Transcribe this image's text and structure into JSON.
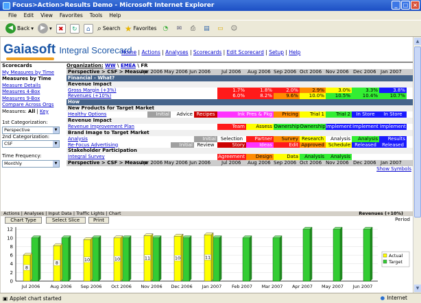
{
  "window": {
    "title": "Focus>Action>Results Demo - Microsoft Internet Explorer",
    "menu": [
      "File",
      "Edit",
      "View",
      "Favorites",
      "Tools",
      "Help"
    ],
    "toolbar": {
      "back": "Back",
      "search": "Search",
      "favorites": "Favorites"
    },
    "status": "Applet chart started",
    "zone": "Internet"
  },
  "header": {
    "logo": "Gaiasoft",
    "product": "Integral Scorecard",
    "nav": [
      "Home",
      "Actions",
      "Analyses",
      "Scorecards",
      "Edit Scorecard",
      "Setup",
      "Help"
    ]
  },
  "left": {
    "scorecards_title": "Scorecards",
    "my_measures": "My Measures by Time",
    "measures_by_time": "Measures by Time",
    "links": [
      "Measure Details",
      "Measures 4-Box",
      "Measures 9-Box",
      "Compare Across Orgs"
    ],
    "measures_label": "Measures:",
    "measures_all": "All",
    "measures_key": "Key",
    "cat1_label": "1st Categorization:",
    "cat1_value": "Perspective",
    "cat2_label": "2nd Categorization:",
    "cat2_value": "CSF",
    "freq_label": "Time Frequency:",
    "freq_value": "Monthly"
  },
  "org": {
    "label": "Organization:",
    "path": [
      "WW",
      "EMEA",
      "FR"
    ],
    "sep": "\\"
  },
  "grid": {
    "perspective_header": "Perspective > CSF > Measure",
    "header_range_text": "Apr 2006 May 2006 Jun 2006",
    "months": [
      "Jul 2006",
      "Aug 2006",
      "Sep 2006",
      "Oct 2006",
      "Nov 2006",
      "Dec 2006",
      "Jan 2007"
    ],
    "financial_section": "Financial - What?",
    "revenue_impact": "Revenue Impact",
    "gross_margin": {
      "label": "Gross Margin (+3%)",
      "values": [
        "1.7%",
        "1.8%",
        "2.0%",
        "2.9%",
        "3.0%",
        "3.3%",
        "3.8%"
      ]
    },
    "revenues": {
      "label": "Revenues (+10%)",
      "values": [
        "6.0%",
        "8.2%",
        "9.6%",
        "10.0%",
        "10.5%",
        "10.4%",
        "10.7%"
      ]
    },
    "how_section": "How",
    "new_products": "New Products for Target Market",
    "healthy_options": {
      "label": "Healthy Options",
      "cells": [
        "Initial",
        "Advice",
        "Recipes",
        "Ink",
        "Pres & Pkg",
        "Pricing",
        "Trial 1",
        "Trial 2",
        "In Store",
        "In Store"
      ]
    },
    "revenue_impact2": "Revenue Impact",
    "rev_improve": {
      "label": "Revenue Improvement Plan",
      "cells": [
        "Team",
        "Assess",
        "Ownership",
        "Ownership",
        "Implement",
        "Implement",
        "Implement"
      ]
    },
    "brand_image": "Brand Image to Target Market",
    "analysis": {
      "label": "Analysis",
      "cells": [
        "Initial",
        "Selection",
        "Partner",
        "Survey",
        "Research",
        "Analysis",
        "Analysis",
        "Results"
      ]
    },
    "refocus": {
      "label": "Re-Focus Advertising",
      "cells": [
        "Initial",
        "Review",
        "Story",
        "Ideas",
        "Edit",
        "Approved",
        "Schedule",
        "Released",
        "Released"
      ]
    },
    "stakeholder": "Stakeholder Participation",
    "integral_survey": {
      "label": "Integral Survey",
      "cells": [
        "Agreement",
        "Design",
        "Data",
        "Analysis",
        "Analysis"
      ]
    },
    "show_symbols": "Show Symbols"
  },
  "lower": {
    "tabs_text": "Actions | Analyses | Input Data | Traffic Lights | Chart",
    "right_title": "Revenues (+10%)",
    "period_label": "Period",
    "buttons": [
      "Chart Type",
      "Select Slice",
      "Print"
    ]
  },
  "colors": {
    "red": "#ff1a1a",
    "orange": "#ff8c00",
    "yellow": "#ffff00",
    "green": "#33ee33",
    "blue": "#1a1aff",
    "darkred": "#cc0000",
    "gray": "#a0a0a0",
    "magenta": "#ff33ff",
    "navy": "#46648a"
  },
  "chart_data": {
    "type": "bar",
    "categories": [
      "Jul 2006",
      "Aug 2006",
      "Sep 2006",
      "Oct 2006",
      "Nov 2006",
      "Dec 2006",
      "Jan 2007",
      "Feb 2007",
      "Mar 2007",
      "Apr 2007",
      "May 2007",
      "Jun 2007"
    ],
    "series": [
      {
        "name": "Actual",
        "values": [
          6.0,
          8.2,
          9.6,
          10.0,
          10.5,
          10.4,
          10.7,
          null,
          null,
          null,
          null,
          null
        ]
      },
      {
        "name": "Target",
        "values": [
          10,
          10,
          10,
          10,
          10,
          10,
          10,
          10,
          10,
          12,
          12,
          12
        ]
      }
    ],
    "data_labels": [
      "8",
      "8",
      "10",
      "10",
      "11",
      "10",
      "11"
    ],
    "yticks": [
      0,
      2,
      4,
      6,
      8,
      10,
      12
    ],
    "ylim": [
      0,
      12.5
    ],
    "legend": "right",
    "colors": {
      "Actual": "#ffff00",
      "Target": "#33cc33"
    }
  }
}
